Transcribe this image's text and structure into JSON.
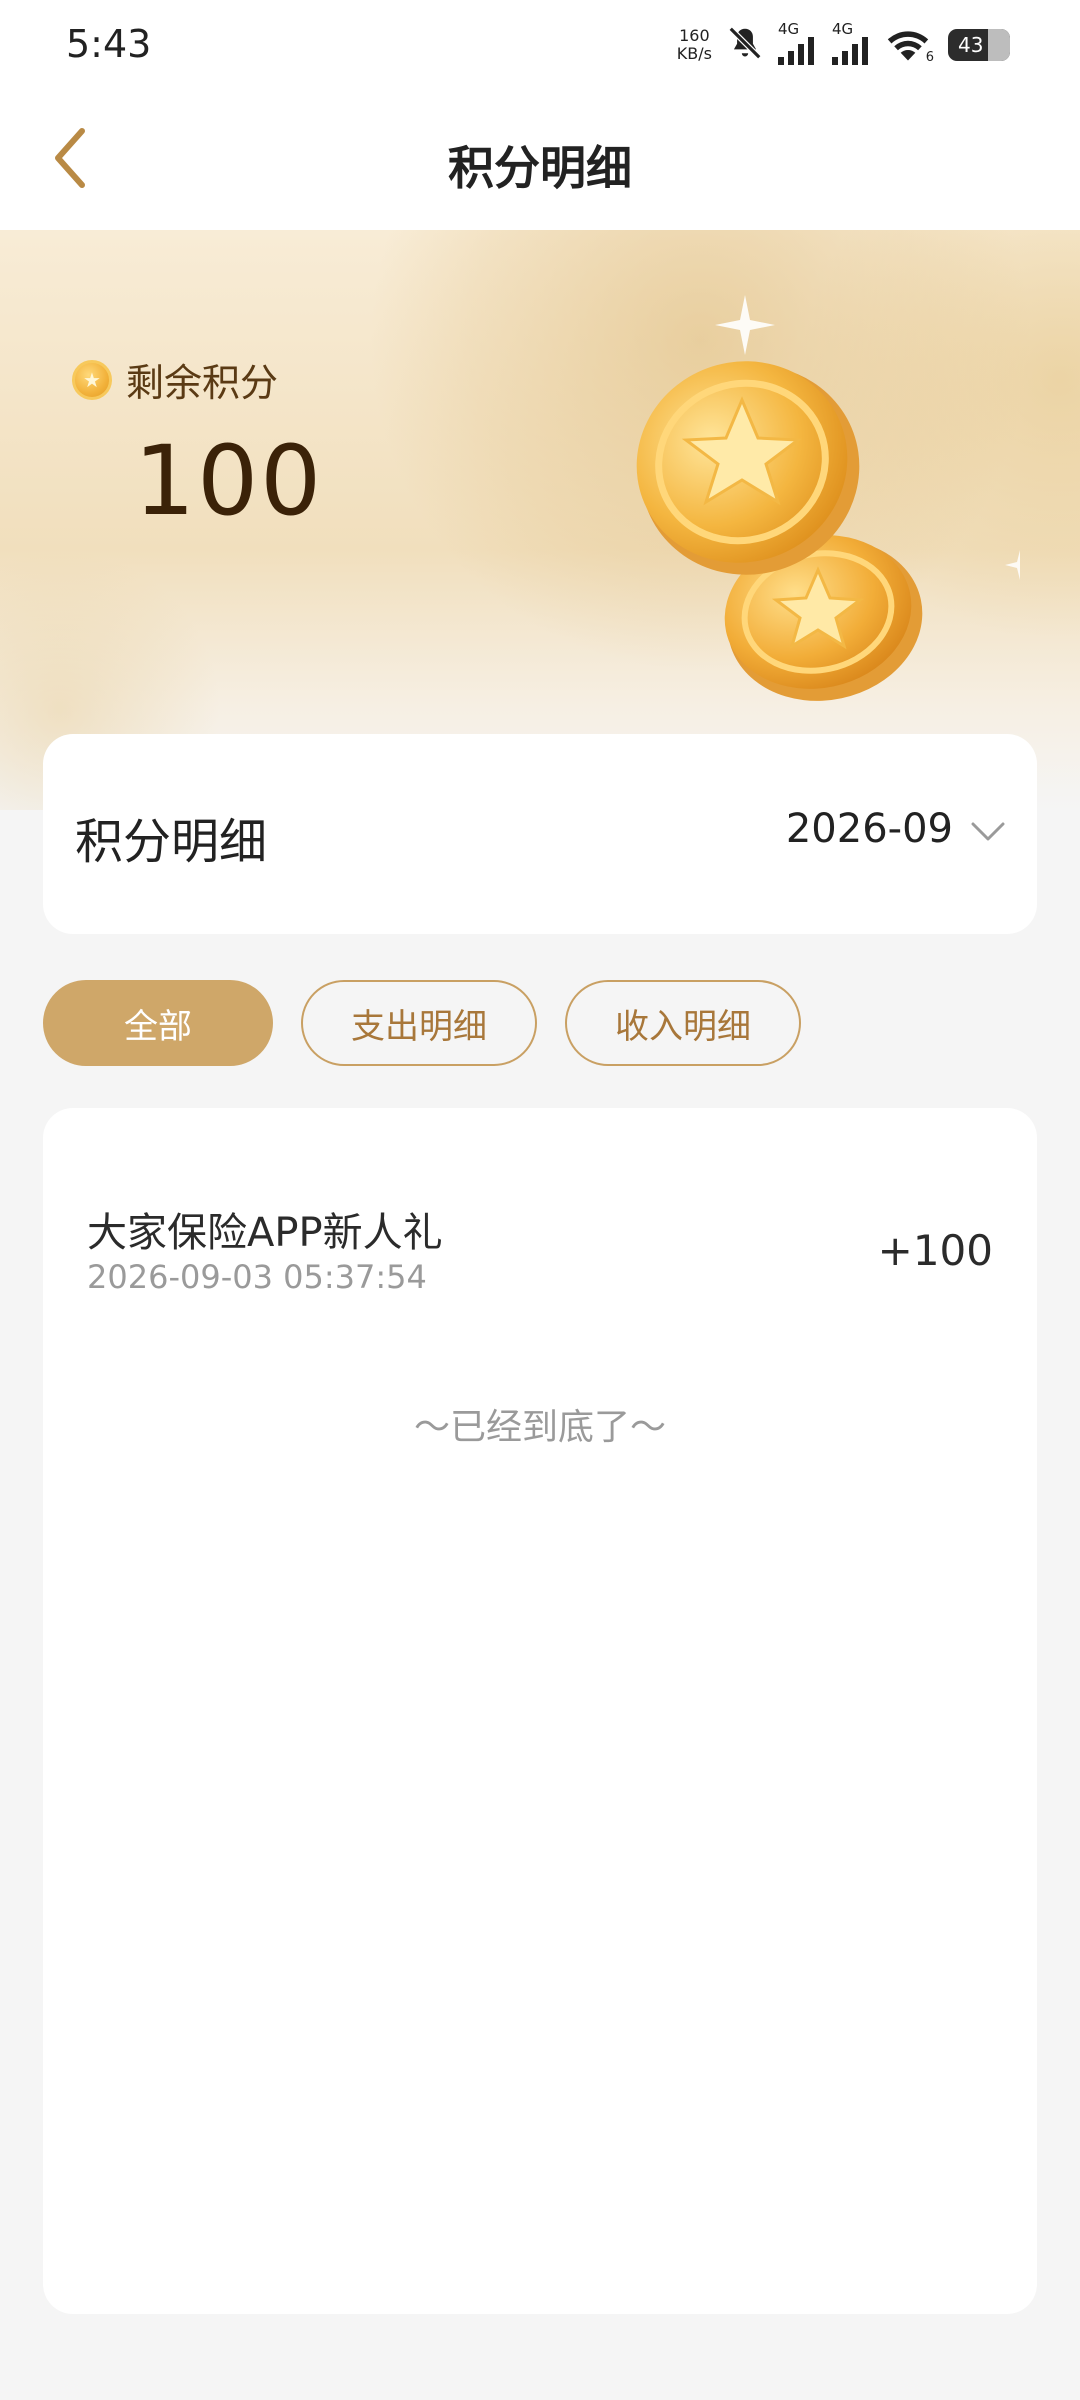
{
  "status_bar": {
    "time": "5:43",
    "net_speed_value": "160",
    "net_speed_unit": "KB/s",
    "signal_1_label": "4G",
    "signal_2_label": "4G",
    "wifi_badge": "6",
    "battery_level": "43",
    "icons": [
      "bell-off-icon",
      "signal-icon",
      "signal-icon",
      "wifi-icon",
      "battery-icon"
    ]
  },
  "nav": {
    "title": "积分明细",
    "back_icon": "chevron-left-icon"
  },
  "banner": {
    "label": "剩余积分",
    "value": "100",
    "coin_glyph": "★"
  },
  "summary": {
    "title": "积分明细",
    "month": "2026-09",
    "dropdown_icon": "chevron-down-icon"
  },
  "filters": [
    {
      "label": "全部",
      "active": true
    },
    {
      "label": "支出明细",
      "active": false
    },
    {
      "label": "收入明细",
      "active": false
    }
  ],
  "records": [
    {
      "title": "大家保险APP新人礼",
      "time": "2026-09-03 05:37:54",
      "amount": "+100"
    }
  ],
  "end_tip": "～已经到底了～",
  "colors": {
    "accent": "#cfa769",
    "accent_text": "#a8773a",
    "page_bg": "#f5f5f5"
  }
}
